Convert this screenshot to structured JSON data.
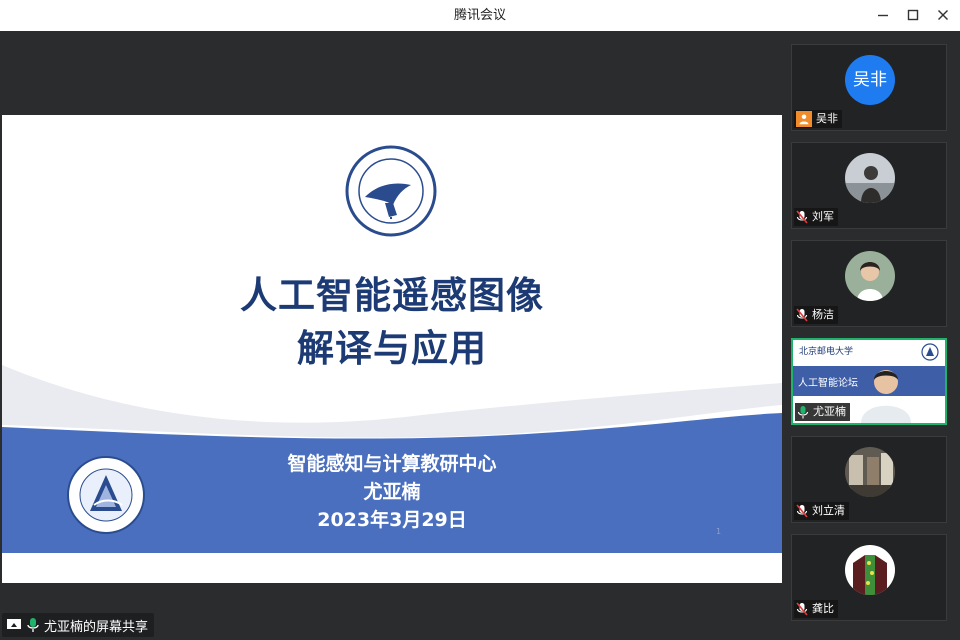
{
  "window": {
    "title": "腾讯会议"
  },
  "slide": {
    "title_line1": "人工智能遥感图像",
    "title_line2": "解译与应用",
    "subtitle_line1": "智能感知与计算教研中心",
    "subtitle_line2": "尤亚楠",
    "subtitle_line3": "2023年3月29日",
    "page_number": "1"
  },
  "share_badge": {
    "label": "尤亚楠的屏幕共享"
  },
  "participants": [
    {
      "name": "吴非",
      "avatar_text": "吴非",
      "icon": "person-icon"
    },
    {
      "name": "刘军",
      "icon": "mic-muted-icon"
    },
    {
      "name": "杨洁",
      "icon": "mic-muted-icon"
    },
    {
      "name": "尤亚楠",
      "icon": "mic-icon",
      "speaking": true,
      "preview_text": "人工智能论坛",
      "preview_header": "北京邮电大学"
    },
    {
      "name": "刘立清",
      "icon": "mic-muted-icon"
    },
    {
      "name": "龚比",
      "icon": "mic-muted-icon"
    }
  ],
  "colors": {
    "accent_green": "#1fb36b",
    "slide_blue": "#4a6fbe",
    "title_navy": "#1c3a74"
  }
}
